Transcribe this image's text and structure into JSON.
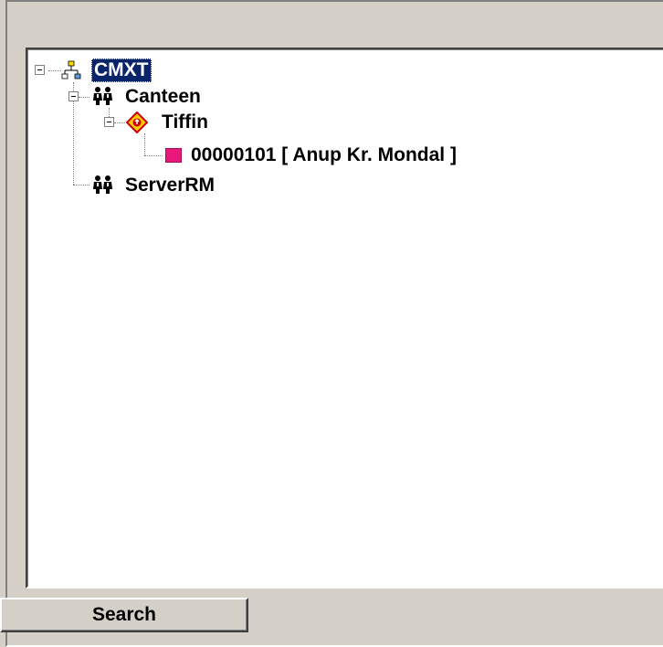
{
  "tree": {
    "root": {
      "label": "CMXT",
      "icon": "network-icon",
      "expanded": true,
      "selected": true
    },
    "nodes": [
      {
        "label": "Canteen",
        "icon": "group-icon",
        "expanded": true
      },
      {
        "label": "Tiffin",
        "icon": "diamond-warning-icon",
        "expanded": true
      },
      {
        "label": "00000101 [ Anup Kr. Mondal ]",
        "icon": "pink-square-icon"
      },
      {
        "label": "ServerRM",
        "icon": "group-icon"
      }
    ]
  },
  "search_button": {
    "label": "Search"
  },
  "colors": {
    "selection": "#0a246a",
    "pink_square": "#e8197a",
    "diamond_fill": "#ffcc00",
    "diamond_border": "#cc0000"
  }
}
